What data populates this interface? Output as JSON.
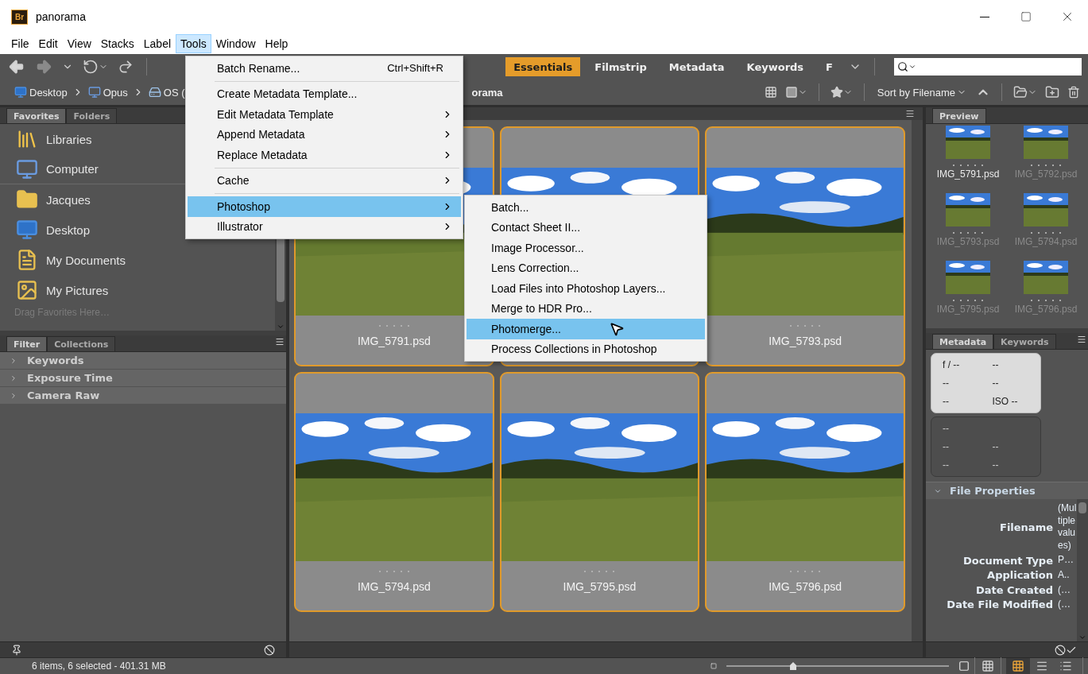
{
  "window": {
    "logo": "Br",
    "title": "panorama"
  },
  "menu_bar": [
    {
      "label": "File",
      "selected": false
    },
    {
      "label": "Edit",
      "selected": false
    },
    {
      "label": "View",
      "selected": false
    },
    {
      "label": "Stacks",
      "selected": false
    },
    {
      "label": "Label",
      "selected": false
    },
    {
      "label": "Tools",
      "selected": true
    },
    {
      "label": "Window",
      "selected": false
    },
    {
      "label": "Help",
      "selected": false
    }
  ],
  "workspaces": [
    {
      "label": "Essentials",
      "selected": true
    },
    {
      "label": "Filmstrip",
      "selected": false
    },
    {
      "label": "Metadata",
      "selected": false
    },
    {
      "label": "Keywords",
      "selected": false
    },
    {
      "label": "F",
      "selected": false
    }
  ],
  "breadcrumb": [
    {
      "label": "Desktop",
      "kind": "desktop"
    },
    {
      "label": "Opus",
      "kind": "computer"
    },
    {
      "label": "OS (",
      "kind": "drive"
    }
  ],
  "breadcrumb_current": "orama",
  "sort": {
    "label": "Sort by Filename"
  },
  "favorites_panel": {
    "tabs": [
      {
        "label": "Favorites",
        "selected": true
      },
      {
        "label": "Folders",
        "selected": false
      }
    ],
    "items": [
      {
        "label": "Libraries",
        "kind": "libraries"
      },
      {
        "label": "Computer",
        "kind": "computer"
      },
      {
        "label": "Jacques",
        "kind": "folder"
      },
      {
        "label": "Desktop",
        "kind": "desktop"
      },
      {
        "label": "My Documents",
        "kind": "documents"
      },
      {
        "label": "My Pictures",
        "kind": "pictures"
      }
    ],
    "hint": "Drag Favorites Here…"
  },
  "filter_panel": {
    "tabs": [
      {
        "label": "Filter",
        "selected": true
      },
      {
        "label": "Collections",
        "selected": false
      }
    ],
    "sections": [
      {
        "label": "Keywords",
        "expanded": false
      },
      {
        "label": "Exposure Time",
        "expanded": false
      },
      {
        "label": "Camera Raw",
        "expanded": false
      }
    ]
  },
  "content": {
    "thumbnails": [
      {
        "label": "IMG_5791.psd",
        "selected": true,
        "stars": 0
      },
      {
        "selected": true
      },
      {
        "label": "IMG_5793.psd",
        "selected": true,
        "stars": 0
      },
      {
        "label": "IMG_5794.psd",
        "selected": true,
        "stars": 0
      },
      {
        "label": "IMG_5795.psd",
        "selected": true,
        "stars": 0
      },
      {
        "label": "IMG_5796.psd",
        "selected": true,
        "stars": 0
      }
    ]
  },
  "tools_menu": {
    "items": [
      {
        "kind": "item",
        "label": "Batch Rename...",
        "shortcut": "Ctrl+Shift+R",
        "submenu": false,
        "selected": false
      },
      {
        "kind": "separator"
      },
      {
        "kind": "item",
        "label": "Create Metadata Template...",
        "submenu": false,
        "selected": false
      },
      {
        "kind": "item",
        "label": "Edit Metadata Template",
        "submenu": true,
        "selected": false
      },
      {
        "kind": "item",
        "label": "Append Metadata",
        "submenu": true,
        "selected": false
      },
      {
        "kind": "item",
        "label": "Replace Metadata",
        "submenu": true,
        "selected": false
      },
      {
        "kind": "separator"
      },
      {
        "kind": "item",
        "label": "Cache",
        "submenu": true,
        "selected": false
      },
      {
        "kind": "separator"
      },
      {
        "kind": "item",
        "label": "Photoshop",
        "submenu": true,
        "selected": true
      },
      {
        "kind": "item",
        "label": "Illustrator",
        "submenu": true,
        "selected": false
      }
    ]
  },
  "photoshop_submenu": {
    "items": [
      {
        "label": "Batch...",
        "selected": false
      },
      {
        "label": "Contact Sheet II...",
        "selected": false
      },
      {
        "label": "Image Processor...",
        "selected": false
      },
      {
        "label": "Lens Correction...",
        "selected": false
      },
      {
        "label": "Load Files into Photoshop Layers...",
        "selected": false
      },
      {
        "label": "Merge to HDR Pro...",
        "selected": false
      },
      {
        "label": "Photomerge...",
        "selected": true
      },
      {
        "label": "Process Collections in Photoshop",
        "selected": false
      }
    ]
  },
  "preview_panel": {
    "tabs": [
      {
        "label": "Preview",
        "selected": true
      }
    ],
    "thumbnails": [
      {
        "label": "IMG_5791.psd",
        "selected": true
      },
      {
        "label": "IMG_5792.psd",
        "selected": false
      },
      {
        "label": "IMG_5793.psd",
        "selected": false
      },
      {
        "label": "IMG_5794.psd",
        "selected": false
      },
      {
        "label": "IMG_5795.psd",
        "selected": false
      },
      {
        "label": "IMG_5796.psd",
        "selected": false
      }
    ]
  },
  "metadata_panel": {
    "tabs": [
      {
        "label": "Metadata",
        "selected": true
      },
      {
        "label": "Keywords",
        "selected": false
      }
    ],
    "camera_rows": [
      [
        "f / --",
        "--"
      ],
      [
        "--",
        "--"
      ],
      [
        "--",
        "ISO --"
      ]
    ],
    "exposure_rows": [
      [
        "--"
      ],
      [
        "--",
        "--"
      ],
      [
        "--",
        "--"
      ]
    ],
    "file_properties": {
      "title": "File Properties",
      "expanded": true,
      "rows": [
        {
          "label": "Filename",
          "value": "(Multiple values)"
        },
        {
          "label": "Document Type",
          "value": "P…"
        },
        {
          "label": "Application",
          "value": "A.."
        },
        {
          "label": "Date Created",
          "value": "(…"
        },
        {
          "label": "Date File Modified",
          "value": "(…"
        }
      ]
    }
  },
  "status_bar": {
    "text": "6 items, 6 selected - 401.31 MB",
    "thumbnail_size": {
      "level": 0.3
    }
  },
  "view_modes": [
    {
      "kind": "grid",
      "selected": true
    },
    {
      "kind": "details",
      "selected": false
    },
    {
      "kind": "list",
      "selected": false
    }
  ]
}
